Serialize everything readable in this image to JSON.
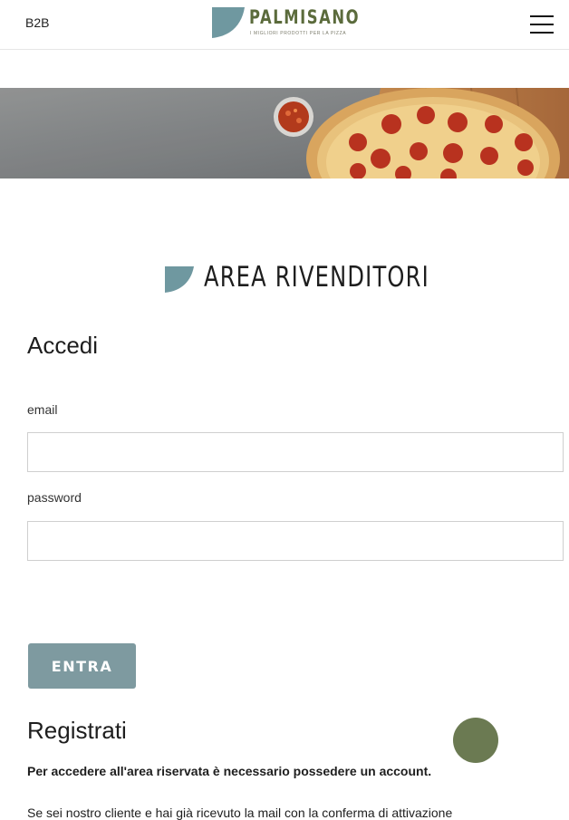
{
  "header": {
    "b2b_label": "B2B",
    "logo_name": "PALMISANO",
    "logo_tagline": "I MIGLIORI PRODOTTI PER LA PIZZA",
    "menu_icon": "hamburger-menu-icon"
  },
  "banner": {
    "description_icon": "pizza-banner-image"
  },
  "section": {
    "title": "AREA RIVENDITORI"
  },
  "login": {
    "title": "Accedi",
    "email_label": "email",
    "email_value": "",
    "password_label": "password",
    "password_value": "",
    "submit_label": "ENTRA"
  },
  "register": {
    "title": "Registrati",
    "note": "Per accedere all'area riservata è necessario possedere un account.",
    "more_text": "Se sei nostro cliente e hai già ricevuto la mail con la conferma di attivazione"
  },
  "colors": {
    "brand_olive": "#5b6b3c",
    "accent_teal": "#6f98a0",
    "button": "#7e9aa0",
    "chat_bubble": "#6b7a52"
  }
}
